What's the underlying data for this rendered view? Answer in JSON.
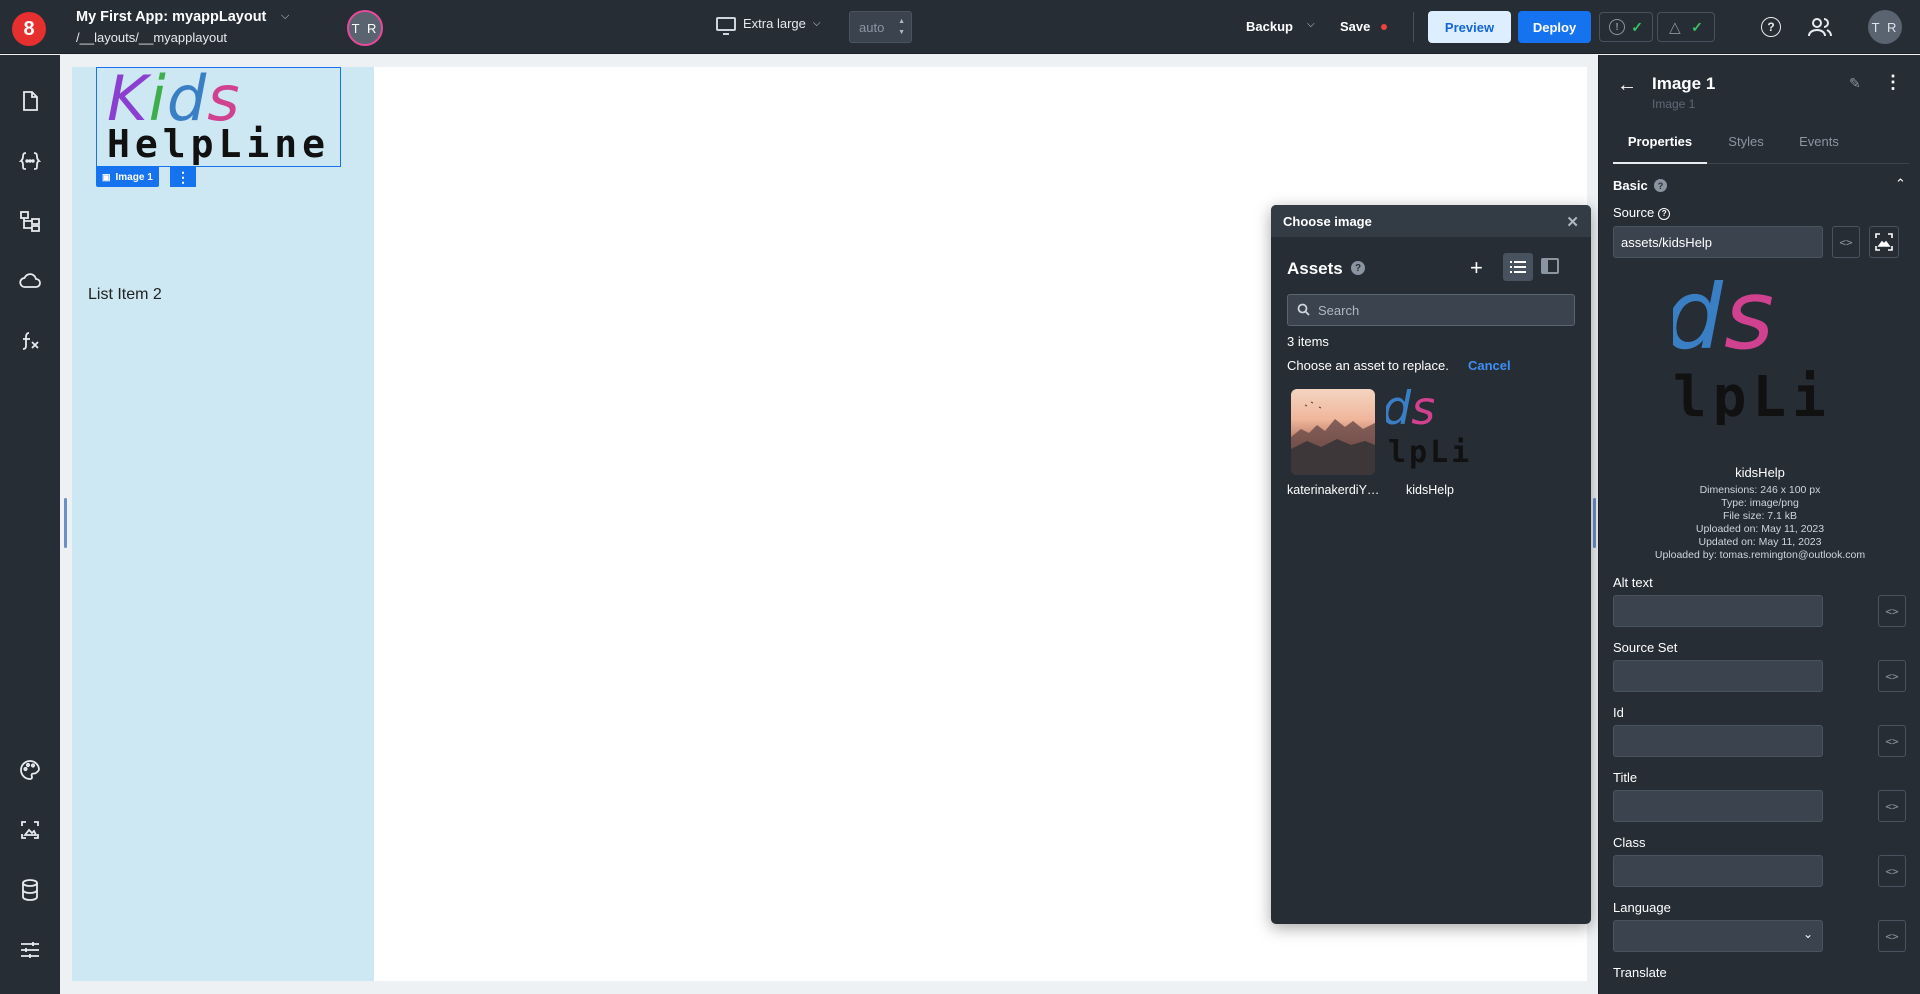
{
  "topbar": {
    "logo": "8",
    "app_title": "My First App: myappLayout",
    "app_path": "/__layouts/__myapplayout",
    "collaborator_initials": "T R",
    "device_label": "Extra large",
    "zoom_value": "auto",
    "backup_label": "Backup",
    "save_label": "Save",
    "preview_label": "Preview",
    "deploy_label": "Deploy",
    "user_initials": "T R"
  },
  "canvas": {
    "image_logo_line1": "Kids",
    "image_logo_line2": "HelpLine",
    "image_tag_label": "Image 1",
    "list_item": "List Item 2"
  },
  "dialog": {
    "title": "Choose image",
    "assets_title": "Assets",
    "search_placeholder": "Search",
    "item_count": "3 items",
    "replace_prompt": "Choose an asset to replace.",
    "cancel_label": "Cancel",
    "assets": [
      {
        "label": "katerinakerdiY…"
      },
      {
        "label": "kidsHelp"
      }
    ],
    "thumb_logo_line1": "ds",
    "thumb_logo_line2": "lpLi"
  },
  "properties": {
    "title": "Image 1",
    "subtitle": "Image 1",
    "tabs": [
      "Properties",
      "Styles",
      "Events"
    ],
    "section": "Basic",
    "source_label": "Source",
    "source_value": "assets/kidsHelp",
    "preview_line1": "ds",
    "preview_line2": "lpLi",
    "asset_name": "kidsHelp",
    "meta": [
      "Dimensions: 246 x 100 px",
      "Type: image/png",
      "File size: 7.1 kB",
      "Uploaded on: May 11, 2023",
      "Updated on: May 11, 2023",
      "Uploaded by: tomas.remington@outlook.com"
    ],
    "fields": [
      "Alt text",
      "Source Set",
      "Id",
      "Title",
      "Class",
      "Language",
      "Translate"
    ],
    "code_glyph": "<>"
  },
  "colors": {
    "accent": "#1673ef",
    "dark_bg": "#262d35",
    "canvas_column": "#cde8f3",
    "save_dot": "#f04040",
    "check": "#3ac26a",
    "kids_k": "#8a3fd1",
    "kids_i": "#3cae4a",
    "kids_d": "#3a7fc4",
    "kids_s": "#d0418f"
  }
}
